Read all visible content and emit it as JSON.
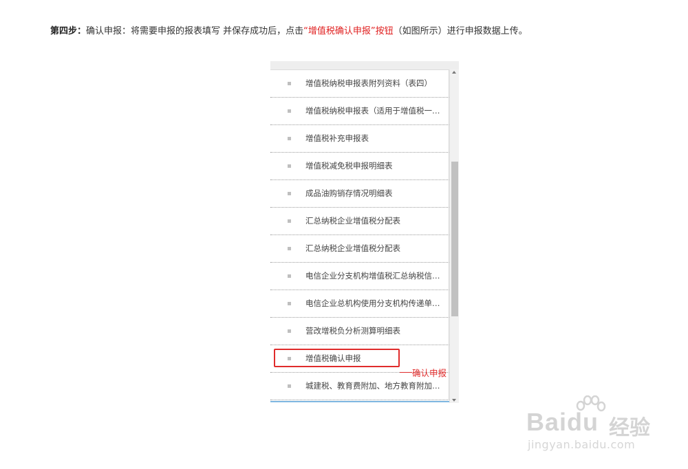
{
  "instruction": {
    "step_label": "第四步：",
    "text_before": "确认申报：将需要申报的报表填写 并保存成功后，点击",
    "highlight": "“增值税确认申报”按钮",
    "text_after": "（如图所示）进行申报数据上传。"
  },
  "report_list": {
    "items": [
      {
        "label": "增值税纳税申报表附列资料（表四）"
      },
      {
        "label": "增值税纳税申报表（适用于增值税一般..."
      },
      {
        "label": "增值税补充申报表"
      },
      {
        "label": "增值税减免税申报明细表"
      },
      {
        "label": "成品油购销存情况明细表"
      },
      {
        "label": "汇总纳税企业增值税分配表"
      },
      {
        "label": "汇总纳税企业增值税分配表"
      },
      {
        "label": "电信企业分支机构增值税汇总纳税信息..."
      },
      {
        "label": "电信企业总机构使用分支机构传递单情..."
      },
      {
        "label": "营改增税负分析测算明细表"
      },
      {
        "label": "增值税确认申报"
      },
      {
        "label": "城建税、教育费附加、地方教育附加税..."
      }
    ]
  },
  "callout": {
    "text": "确认申报"
  },
  "watermark": {
    "brand": "Bai",
    "brand_suffix": "du",
    "product": "经验",
    "url": "jingyan.baidu.com"
  },
  "colors": {
    "accent_red": "#e02020",
    "scroll_thumb": "#c1c1c1",
    "watermark_gray": "#d4d4d4"
  }
}
